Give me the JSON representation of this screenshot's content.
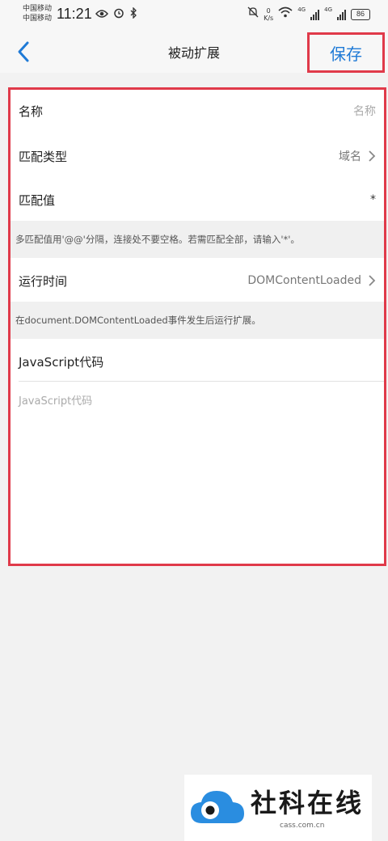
{
  "status_bar": {
    "carrier_1": "中国移动",
    "carrier_2": "中国移动",
    "time": "11:21",
    "speed_value": "0",
    "speed_unit": "K/s",
    "net_1": "4G",
    "net_2": "4G",
    "battery": "86"
  },
  "nav": {
    "title": "被动扩展",
    "save_label": "保存",
    "accent_color": "#1f7ad6"
  },
  "form": {
    "name": {
      "label": "名称",
      "placeholder": "名称"
    },
    "match_type": {
      "label": "匹配类型",
      "value": "域名"
    },
    "match_value": {
      "label": "匹配值",
      "value": "*"
    },
    "match_hint": "多匹配值用'@@'分隔，连接处不要空格。若需匹配全部，请输入'*'。",
    "run_time": {
      "label": "运行时间",
      "value": "DOMContentLoaded"
    },
    "run_time_hint": "在document.DOMContentLoaded事件发生后运行扩展。",
    "js": {
      "label": "JavaScript代码",
      "placeholder": "JavaScript代码"
    }
  },
  "watermark": {
    "text": "社科在线",
    "url": "cass.com.cn"
  },
  "highlight_color": "#e03a4a"
}
